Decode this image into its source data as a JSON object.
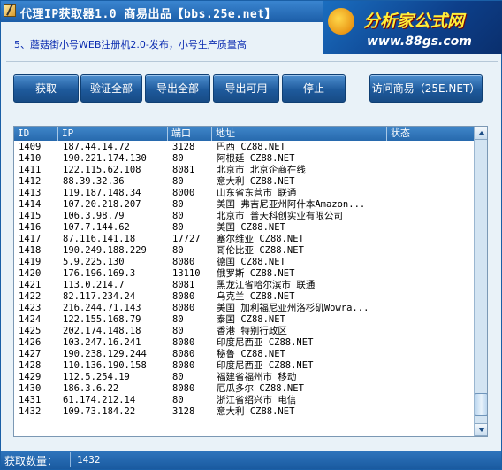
{
  "window": {
    "title": "代理IP获取器1.0 商易出品【bbs.25e.net】"
  },
  "ad": {
    "title": "分析家公式网",
    "url": "www.88gs.com"
  },
  "notice": "5、蘑菇街小号WEB注册机2.0-发布，小号生产质量高",
  "toolbar": {
    "fetch": "获取",
    "verify_all": "验证全部",
    "export_all": "导出全部",
    "export_valid": "导出可用",
    "stop": "停止",
    "visit": "访问商易（25E.NET）"
  },
  "table": {
    "columns": [
      "ID",
      "IP",
      "端口",
      "地址",
      "状态"
    ],
    "rows": [
      [
        "1409",
        "187.44.14.72",
        "3128",
        "巴西 CZ88.NET",
        ""
      ],
      [
        "1410",
        "190.221.174.130",
        "80",
        "阿根廷 CZ88.NET",
        ""
      ],
      [
        "1411",
        "122.115.62.108",
        "8081",
        "北京市 北京企商在线",
        ""
      ],
      [
        "1412",
        "88.39.32.36",
        "80",
        "意大利 CZ88.NET",
        ""
      ],
      [
        "1413",
        "119.187.148.34",
        "8000",
        "山东省东营市 联通",
        ""
      ],
      [
        "1414",
        "107.20.218.207",
        "80",
        "美国 弗吉尼亚州阿什本Amazon...",
        ""
      ],
      [
        "1415",
        "106.3.98.79",
        "80",
        "北京市 普天科创实业有限公司",
        ""
      ],
      [
        "1416",
        "107.7.144.62",
        "80",
        "美国 CZ88.NET",
        ""
      ],
      [
        "1417",
        "87.116.141.18",
        "17727",
        "塞尔维亚 CZ88.NET",
        ""
      ],
      [
        "1418",
        "190.249.188.229",
        "80",
        "哥伦比亚 CZ88.NET",
        ""
      ],
      [
        "1419",
        "5.9.225.130",
        "8080",
        "德国 CZ88.NET",
        ""
      ],
      [
        "1420",
        "176.196.169.3",
        "13110",
        "俄罗斯 CZ88.NET",
        ""
      ],
      [
        "1421",
        "113.0.214.7",
        "8081",
        "黑龙江省哈尔滨市 联通",
        ""
      ],
      [
        "1422",
        "82.117.234.24",
        "8080",
        "乌克兰 CZ88.NET",
        ""
      ],
      [
        "1423",
        "216.244.71.143",
        "8080",
        "美国 加利福尼亚州洛杉矶Wowra...",
        ""
      ],
      [
        "1424",
        "122.155.168.79",
        "80",
        "泰国 CZ88.NET",
        ""
      ],
      [
        "1425",
        "202.174.148.18",
        "80",
        "香港 特别行政区",
        ""
      ],
      [
        "1426",
        "103.247.16.241",
        "8080",
        "印度尼西亚 CZ88.NET",
        ""
      ],
      [
        "1427",
        "190.238.129.244",
        "8080",
        "秘鲁 CZ88.NET",
        ""
      ],
      [
        "1428",
        "110.136.190.158",
        "8080",
        "印度尼西亚 CZ88.NET",
        ""
      ],
      [
        "1429",
        "112.5.254.19",
        "80",
        "福建省福州市 移动",
        ""
      ],
      [
        "1430",
        "186.3.6.22",
        "8080",
        "厄瓜多尔 CZ88.NET",
        ""
      ],
      [
        "1431",
        "61.174.212.14",
        "80",
        "浙江省绍兴市 电信",
        ""
      ],
      [
        "1432",
        "109.73.184.22",
        "3128",
        "意大利 CZ88.NET",
        ""
      ]
    ]
  },
  "status": {
    "label": "获取数量：",
    "value": "1432"
  },
  "colors": {
    "titlebar": "#1c5ea8",
    "button": "#1e5a9c",
    "header": "#2769ad",
    "notice_text": "#0a2bb0"
  }
}
